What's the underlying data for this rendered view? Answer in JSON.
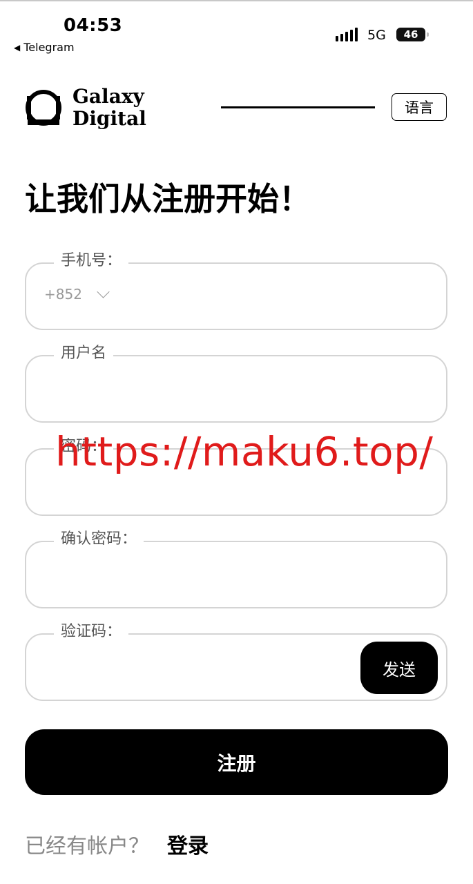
{
  "status_bar": {
    "time": "04:53",
    "back_app": "Telegram",
    "network": "5G",
    "battery": "46"
  },
  "header": {
    "brand_line1": "Galaxy",
    "brand_line2": "Digital",
    "language_button": "语言"
  },
  "page_title": "让我们从注册开始！",
  "form": {
    "phone": {
      "label": "手机号：",
      "country_code": "+852",
      "value": ""
    },
    "username": {
      "label": "用户名",
      "value": ""
    },
    "password": {
      "label": "密码：",
      "value": ""
    },
    "confirm_password": {
      "label": "确认密码：",
      "value": ""
    },
    "verification_code": {
      "label": "验证码：",
      "value": "",
      "send_label": "发送"
    },
    "submit_label": "注册"
  },
  "footer": {
    "question": "已经有帐户？",
    "login_link": "登录"
  },
  "watermark": "https://maku6.top/",
  "colors": {
    "primary": "#000000",
    "field_border": "#d4d4d4",
    "watermark": "#e01b1b",
    "muted_text": "#888888"
  },
  "icons": {
    "logo": "galaxy-logo-icon",
    "signal": "cellular-signal-icon",
    "back": "back-triangle-icon",
    "chevron": "chevron-down-icon"
  }
}
